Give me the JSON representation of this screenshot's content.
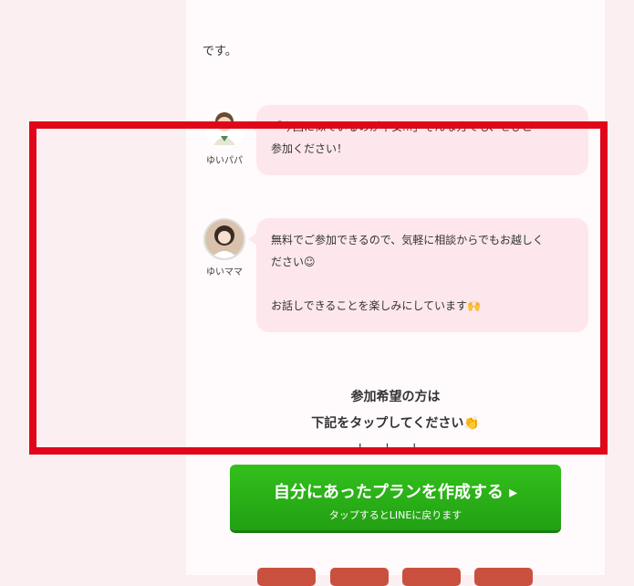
{
  "intro_text": "です。",
  "chat": [
    {
      "speaker": "ゆいパパ",
      "lines": [
        "「今回に似ているのが不安...」そんな方でも、ぜひご",
        "参加ください！"
      ]
    },
    {
      "speaker": "ゆいママ",
      "lines": [
        "無料でご参加できるので、気軽に相談からでもお越しく",
        "ださい☺",
        "",
        "お話しできることを楽しみにしています🙌"
      ]
    }
  ],
  "cta": {
    "heading_line1": "参加希望の方は",
    "heading_line2": "下記をタップしてください👏",
    "arrows": "↓↓↓",
    "button_label": "自分にあったプランを作成する ▸",
    "button_sub": "タップするとLINEに戻ります"
  },
  "colors": {
    "highlight": "#e1071a",
    "bubble": "#fde7ec",
    "cta_button": "#2ab418"
  }
}
